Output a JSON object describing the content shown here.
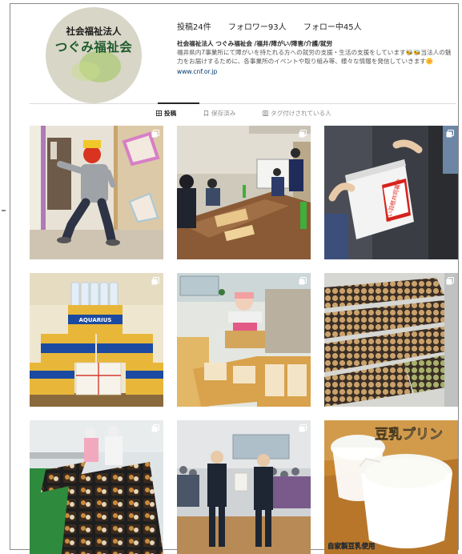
{
  "profile": {
    "avatar": {
      "org_prefix": "社会福祉法人",
      "org_name": "つぐみ福祉会"
    },
    "stats": {
      "posts": "投稿24件",
      "followers": "フォロワー93人",
      "following": "フォロー中45人"
    },
    "bio": {
      "name": "社会福祉法人 つぐみ福祉会 /福井/障がい/障害/介護/就労",
      "text": "福井県内7事業所にて障がいを持たれる方への就労の支援・生活の支援をしています🐝🐝当法人の魅力をお届けするために、各事業所のイベントや取り組み等、様々な情報を発信していきます🌼",
      "link": "www.cnf.or.jp"
    }
  },
  "tabs": [
    {
      "label": "投稿",
      "icon": "grid-icon",
      "active": true
    },
    {
      "label": "保存済み",
      "icon": "bookmark-icon",
      "active": false
    },
    {
      "label": "タグ付けされている人",
      "icon": "tag-person-icon",
      "active": false
    }
  ],
  "posts": [
    {
      "id": "post-1",
      "caption": "",
      "multi": true
    },
    {
      "id": "post-2",
      "caption": "",
      "multi": true
    },
    {
      "id": "post-3",
      "caption": "",
      "multi": true,
      "sign_text": "赤い羽根共同募金"
    },
    {
      "id": "post-4",
      "caption": "",
      "multi": true,
      "sign_text": "AQUARIUS"
    },
    {
      "id": "post-5",
      "caption": "",
      "multi": true
    },
    {
      "id": "post-6",
      "caption": "",
      "multi": true
    },
    {
      "id": "post-7",
      "caption": "",
      "multi": true
    },
    {
      "id": "post-8",
      "caption": "",
      "multi": true
    },
    {
      "id": "post-9",
      "caption": "",
      "multi": true,
      "title_text": "豆乳プリン",
      "footer_text": "自家製豆乳使用"
    }
  ],
  "colors": {
    "link": "#00376b",
    "logo_green": "#1c5a2a",
    "divider": "#dbdbdb"
  }
}
